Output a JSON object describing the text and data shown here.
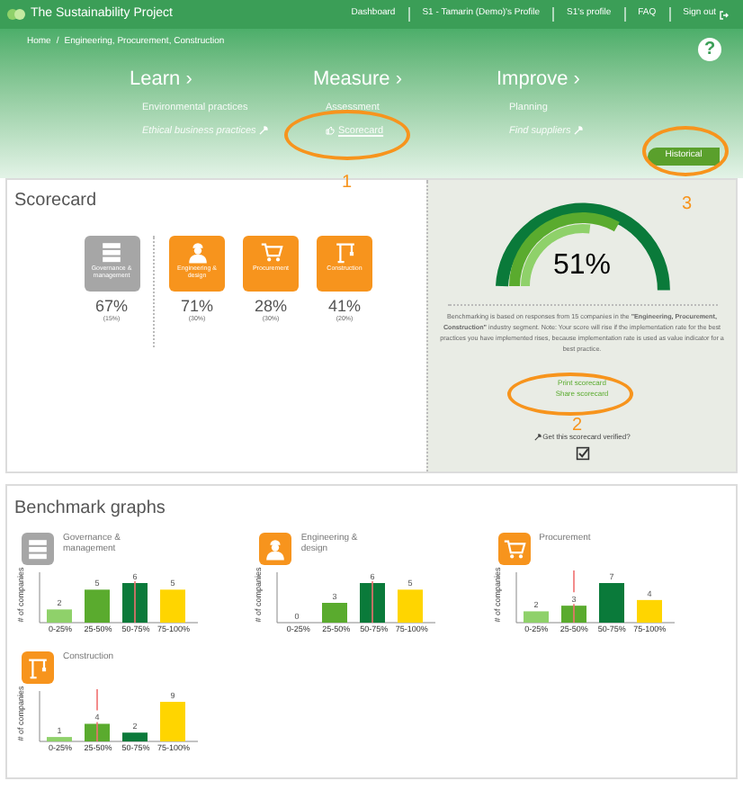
{
  "nav": {
    "logo": "The Sustainability Project",
    "links": [
      "Dashboard",
      "S1 - Tamarin (Demo)'s Profile",
      "S1's profile",
      "FAQ",
      "Sign out"
    ]
  },
  "breadcrumb": {
    "separator": "/",
    "items": [
      "Home",
      "Engineering, Procurement, Construction"
    ]
  },
  "help": "?",
  "menu": [
    {
      "title": "Learn ›",
      "items": [
        {
          "label": "Environmental practices",
          "italic": false,
          "selected": false
        },
        {
          "label": "Ethical business practices",
          "italic": true,
          "selected": false
        }
      ]
    },
    {
      "title": "Measure ›",
      "items": [
        {
          "label": "Assessment",
          "italic": false,
          "selected": false
        },
        {
          "label": "Scorecard",
          "italic": false,
          "selected": true
        }
      ]
    },
    {
      "title": "Improve ›",
      "items": [
        {
          "label": "Planning",
          "italic": false,
          "selected": false
        },
        {
          "label": "Find suppliers",
          "italic": true,
          "selected": false
        }
      ]
    }
  ],
  "historical_button": "Historical",
  "annotations": [
    {
      "label": "1"
    },
    {
      "label": "2"
    },
    {
      "label": "3"
    }
  ],
  "scorecard": {
    "title": "Scorecard",
    "categories": [
      {
        "label": "Governance & management",
        "score": "67%",
        "weight": "(15%)",
        "color": "#a6a6a6"
      },
      {
        "label": "Engineering & design",
        "score": "71%",
        "weight": "(30%)",
        "color": "#f7941d"
      },
      {
        "label": "Procurement",
        "score": "28%",
        "weight": "(30%)",
        "color": "#f7941d"
      },
      {
        "label": "Construction",
        "score": "41%",
        "weight": "(20%)",
        "color": "#f7941d"
      }
    ],
    "gauge_value": "51%",
    "note": "Benchmarking is based on responses from 15 companies in the **\"Engineering, Procurement, Construction\"** industry segment. Note: Your score will rise if the implementation rate for the best practices you have implemented rises, because implementation rate is used as value indicator for a best practice.",
    "links": [
      "Print scorecard",
      "Share scorecard"
    ],
    "verify": "Get this scorecard verified?",
    "verified": true
  },
  "benchmark": {
    "title": "Benchmark graphs",
    "graphs": [
      {
        "title": "Governance & management",
        "color": "#a6a6a6",
        "chart_data": {
          "type": "bar",
          "data_labels": true,
          "ylabel": "# of companies",
          "categories": [
            "0-25%",
            "25-50%",
            "50-75%",
            "75-100%"
          ],
          "values": [
            2,
            5,
            6,
            5
          ],
          "annotations": [
            {
              "x": "50-75%"
            }
          ]
        }
      },
      {
        "title": "Engineering & design",
        "color": "#f7941d",
        "chart_data": {
          "type": "bar",
          "data_labels": true,
          "ylabel": "# of companies",
          "categories": [
            "0-25%",
            "25-50%",
            "50-75%",
            "75-100%"
          ],
          "values": [
            0,
            3,
            6,
            5
          ],
          "annotations": [
            {
              "x": "50-75%"
            }
          ]
        }
      },
      {
        "title": "Procurement",
        "color": "#f7941d",
        "chart_data": {
          "type": "bar",
          "data_labels": true,
          "ylabel": "# of companies",
          "categories": [
            "0-25%",
            "25-50%",
            "50-75%",
            "75-100%"
          ],
          "values": [
            2,
            3,
            7,
            4
          ],
          "annotations": [
            {
              "x": "25-50%"
            }
          ]
        }
      },
      {
        "title": "Construction",
        "color": "#f7941d",
        "chart_data": {
          "type": "bar",
          "data_labels": true,
          "ylabel": "# of companies",
          "categories": [
            "0-25%",
            "25-50%",
            "50-75%",
            "75-100%"
          ],
          "values": [
            1,
            4,
            2,
            9
          ],
          "annotations": [
            {
              "x": "25-50%"
            }
          ]
        }
      }
    ]
  }
}
